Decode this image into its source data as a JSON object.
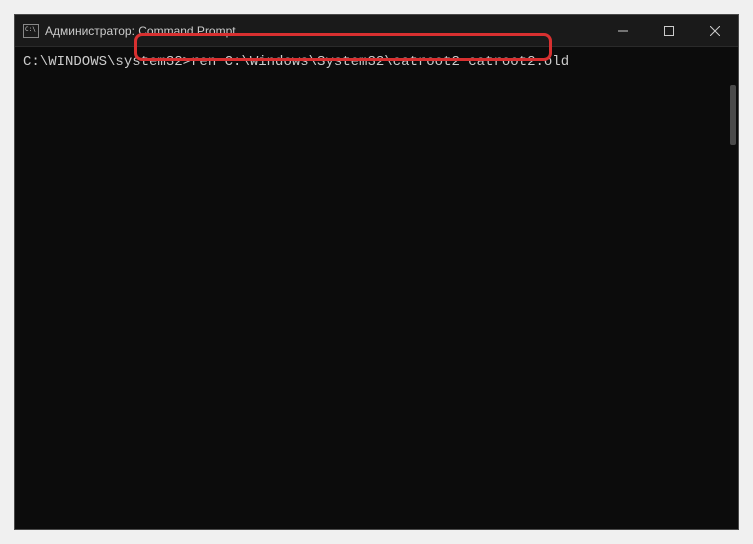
{
  "window": {
    "title": "Администратор: Command Prompt"
  },
  "terminal": {
    "prompt": "C:\\WINDOWS\\system32>",
    "command": "ren C:\\Windows\\System32\\catroot2 catroot2.old"
  },
  "annotation": {
    "highlight_color": "#d83030"
  }
}
